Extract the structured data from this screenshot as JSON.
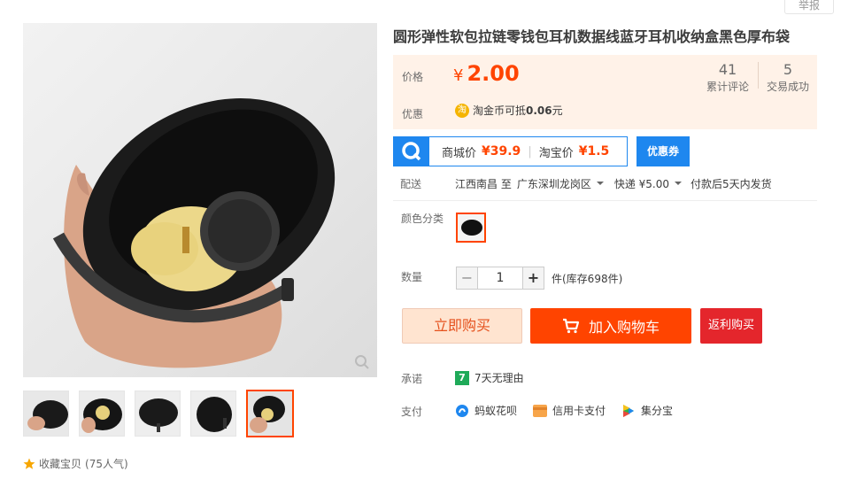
{
  "header": {
    "report_label": "举报"
  },
  "product": {
    "title": "圆形弹性软包拉链零钱包耳机数据线蓝牙耳机收纳盒黑色厚布袋"
  },
  "price_box": {
    "price_label": "价格",
    "currency": "¥",
    "price": "2.00",
    "reviews_count": "41",
    "reviews_label": "累计评论",
    "trades_count": "5",
    "trades_label": "交易成功",
    "promo_label": "优惠",
    "coin_icon_text": "淘",
    "coin_text": "淘金币可抵",
    "coin_value": "0.06",
    "coin_unit": "元"
  },
  "mall": {
    "mall_price_label": "商城价",
    "mall_price": "¥39.9",
    "taobao_price_label": "淘宝价",
    "taobao_price": "¥1.5",
    "coupon_label": "优惠券"
  },
  "shipping": {
    "label": "配送",
    "from": "江西南昌 至",
    "to": "广东深圳龙岗区",
    "method": "快递 ¥5.00",
    "dispatch": "付款后5天内发货"
  },
  "sku": {
    "color_label": "颜色分类"
  },
  "quantity": {
    "label": "数量",
    "minus": "−",
    "value": "1",
    "plus": "+",
    "stock_text": "件(库存698件)"
  },
  "actions": {
    "buy_now": "立即购买",
    "add_to_cart": "加入购物车",
    "rebate_buy": "返利购买"
  },
  "service": {
    "promise_label": "承诺",
    "promise_icon_text": "7",
    "promise_text": "7天无理由",
    "pay_label": "支付",
    "pay_methods": [
      "蚂蚁花呗",
      "信用卡支付",
      "集分宝"
    ]
  },
  "gallery": {
    "favorite_text": "收藏宝贝",
    "popularity": "(75人气)"
  },
  "colors": {
    "accent": "#ff4400",
    "price_bg": "#fff2e8",
    "mall_blue": "#1e87ef",
    "rebate_red": "#e4262c"
  }
}
